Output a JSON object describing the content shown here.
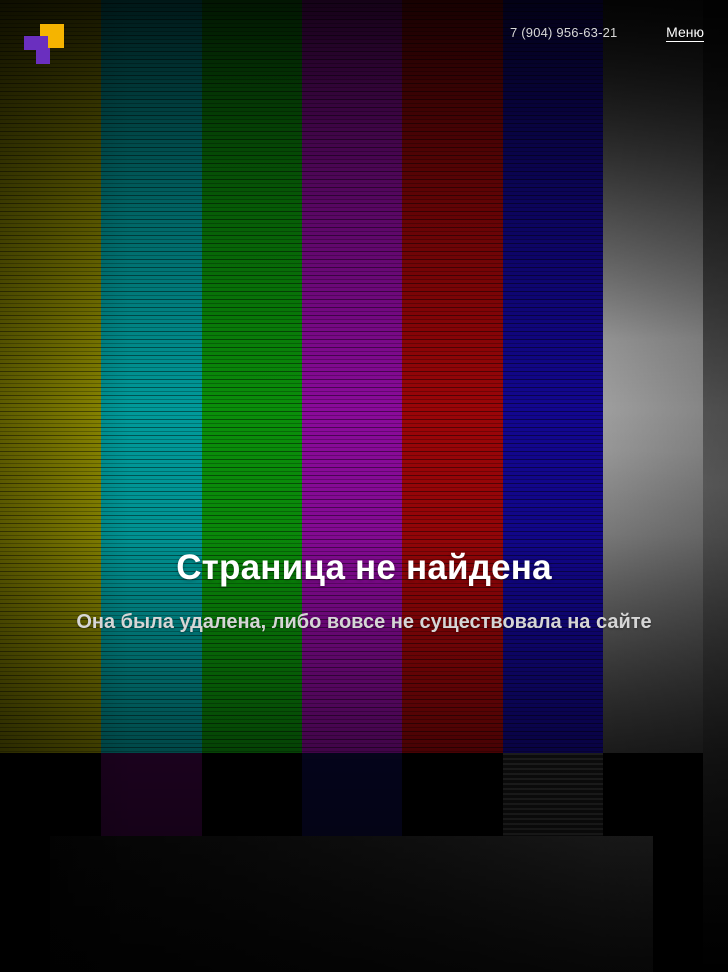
{
  "header": {
    "phone": "7 (904) 956-63-21",
    "menu_label": "Меню"
  },
  "error": {
    "title": "Страница не найдена",
    "subtitle": "Она была удалена, либо вовсе не существовала на сайте"
  },
  "colors": {
    "logo_yellow": "#f5b400",
    "logo_purple": "#6a2fbf",
    "bar_yellow": "#8f8c00",
    "bar_cyan": "#009a9a",
    "bar_green": "#0a8f0a",
    "bar_magenta": "#8a0a9a",
    "bar_red": "#9a0508",
    "bar_blue": "#12068f",
    "bar_gray": "#8c8c8c"
  }
}
